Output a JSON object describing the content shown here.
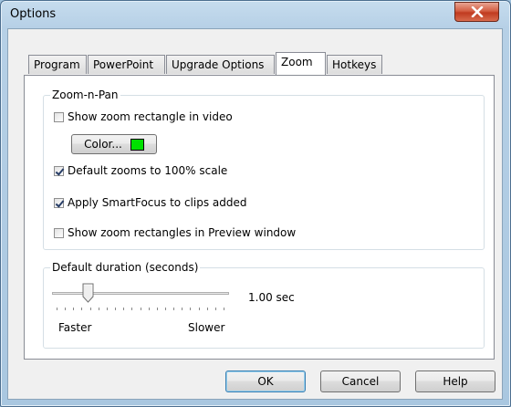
{
  "window": {
    "title": "Options"
  },
  "tabs": [
    {
      "label": "Program",
      "active": false
    },
    {
      "label": "PowerPoint",
      "active": false
    },
    {
      "label": "Upgrade Options",
      "active": false
    },
    {
      "label": "Zoom",
      "active": true
    },
    {
      "label": "Hotkeys",
      "active": false
    }
  ],
  "zoom_group": {
    "legend": "Zoom-n-Pan",
    "show_rect": {
      "label": "Show zoom rectangle in video",
      "checked": false
    },
    "color_button": {
      "label": "Color...",
      "color": "#00e000"
    },
    "default_zoom": {
      "label": "Default zooms to 100% scale",
      "checked": true
    },
    "smartfocus": {
      "label": "Apply SmartFocus to clips added",
      "checked": true
    },
    "preview_rects": {
      "label": "Show zoom rectangles in Preview window",
      "checked": false
    }
  },
  "duration_group": {
    "legend": "Default duration (seconds)",
    "value_text": "1.00 sec",
    "slider_fraction": 0.2,
    "left_label": "Faster",
    "right_label": "Slower"
  },
  "buttons": {
    "ok": "OK",
    "cancel": "Cancel",
    "help": "Help"
  }
}
